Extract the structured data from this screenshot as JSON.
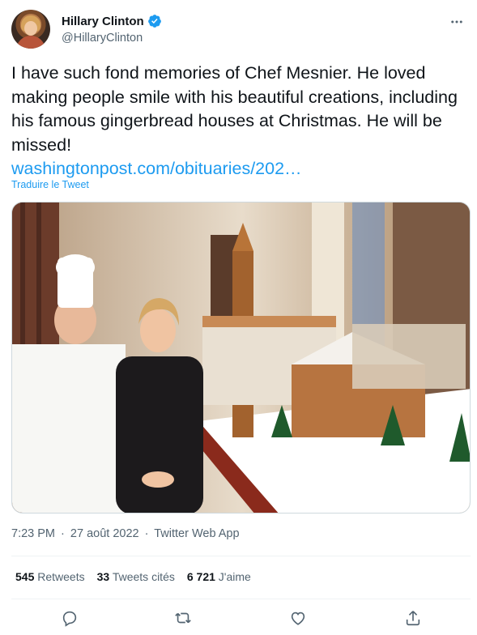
{
  "author": {
    "display_name": "Hillary Clinton",
    "handle": "@HillaryClinton",
    "verified_icon": "verified-badge-icon",
    "avatar": "profile-photo"
  },
  "tweet": {
    "text": "I have such fond memories of Chef Mesnier. He loved making people smile with his beautiful creations, including his famous gingerbread houses at Christmas. He will be missed!",
    "link": "washingtonpost.com/obituaries/202…",
    "translate_label": "Traduire le Tweet",
    "time": "7:23 PM",
    "date": "27 août 2022",
    "separator": "·",
    "source": "Twitter Web App"
  },
  "stats": {
    "retweets_count": "545",
    "retweets_label": "Retweets",
    "quotes_count": "33",
    "quotes_label": "Tweets cités",
    "likes_count": "6 721",
    "likes_label": "J'aime"
  },
  "actions": [
    "reply-icon",
    "retweet-icon",
    "like-icon",
    "share-icon"
  ],
  "colors": {
    "link": "#1d9bf0",
    "secondary_text": "#536471",
    "primary_text": "#0f1419",
    "divider": "#eff3f4"
  }
}
